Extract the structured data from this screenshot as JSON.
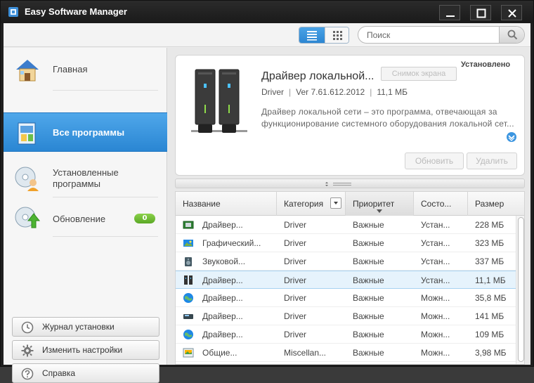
{
  "window": {
    "title": "Easy Software Manager"
  },
  "toolbar": {
    "view_list": "list-view",
    "view_grid": "grid-view",
    "search_placeholder": "Поиск"
  },
  "sidebar": {
    "items": [
      {
        "label": "Главная",
        "icon": "home-icon"
      },
      {
        "label": "Все программы",
        "icon": "all-programs-icon",
        "active": true
      },
      {
        "label": "Установленные",
        "label2": "программы",
        "icon": "installed-programs-icon"
      },
      {
        "label": "Обновление",
        "icon": "update-icon",
        "badge": "0"
      }
    ],
    "buttons": [
      {
        "label": "Журнал установки",
        "icon": "clock-icon"
      },
      {
        "label": "Изменить настройки",
        "icon": "gear-icon"
      },
      {
        "label": "Справка",
        "icon": "help-icon"
      }
    ]
  },
  "detail": {
    "title": "Драйвер локальной...",
    "screenshot_label": "Снимок экрана",
    "status": "Установлено",
    "category": "Driver",
    "version": "Ver 7.61.612.2012",
    "size": "11,1 МБ",
    "description": "Драйвер локальной сети – это программа, отвечающая за функционирование системного оборудования локальной сет...",
    "update_label": "Обновить",
    "delete_label": "Удалить"
  },
  "table": {
    "columns": [
      "Название",
      "Категория",
      "Приоритет",
      "Состо...",
      "Размер"
    ],
    "rows": [
      {
        "name": "Драйвер...",
        "category": "Driver",
        "priority": "Важные",
        "status": "Устан...",
        "size": "228 МБ",
        "icon": "chipset-icon"
      },
      {
        "name": "Графический...",
        "category": "Driver",
        "priority": "Важные",
        "status": "Устан...",
        "size": "323 МБ",
        "icon": "graphics-icon"
      },
      {
        "name": "Звуковой...",
        "category": "Driver",
        "priority": "Важные",
        "status": "Устан...",
        "size": "337 МБ",
        "icon": "audio-icon"
      },
      {
        "name": "Драйвер...",
        "category": "Driver",
        "priority": "Важные",
        "status": "Устан...",
        "size": "11,1 МБ",
        "icon": "lan-icon",
        "selected": true
      },
      {
        "name": "Драйвер...",
        "category": "Driver",
        "priority": "Важные",
        "status": "Можн...",
        "size": "35,8 МБ",
        "icon": "globe-icon"
      },
      {
        "name": "Драйвер...",
        "category": "Driver",
        "priority": "Важные",
        "status": "Можн...",
        "size": "141 МБ",
        "icon": "card-reader-icon"
      },
      {
        "name": "Драйвер...",
        "category": "Driver",
        "priority": "Важные",
        "status": "Можн...",
        "size": "109 МБ",
        "icon": "globe-icon"
      },
      {
        "name": "Общие...",
        "category": "Miscellan...",
        "priority": "Важные",
        "status": "Можн...",
        "size": "3,98 МБ",
        "icon": "app-icon"
      }
    ]
  },
  "colors": {
    "accent": "#2c86d2",
    "badge": "#5aa825",
    "titlebar": "#1f1f1f"
  }
}
